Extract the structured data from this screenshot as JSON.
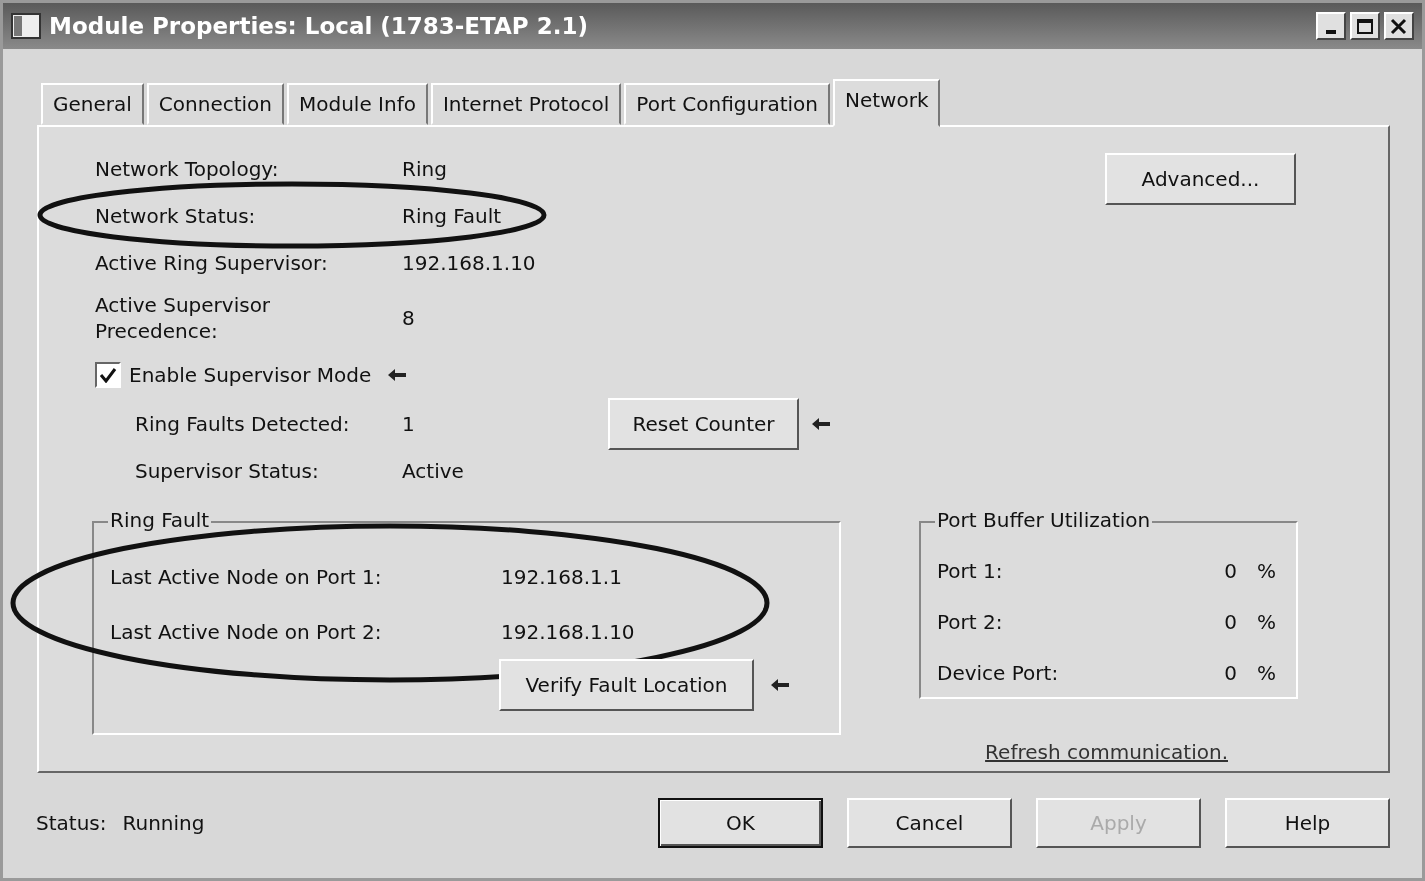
{
  "window": {
    "title": "Module Properties: Local (1783-ETAP 2.1)"
  },
  "tabs": [
    {
      "label": "General",
      "selected": false
    },
    {
      "label": "Connection",
      "selected": false
    },
    {
      "label": "Module Info",
      "selected": false
    },
    {
      "label": "Internet Protocol",
      "selected": false
    },
    {
      "label": "Port Configuration",
      "selected": false
    },
    {
      "label": "Network",
      "selected": true
    }
  ],
  "network": {
    "fields": [
      {
        "label": "Network Topology:",
        "value": "Ring",
        "circled": false
      },
      {
        "label": "Network Status:",
        "value": "Ring Fault",
        "circled": true
      },
      {
        "label": "Active Ring Supervisor:",
        "value": "192.168.1.10",
        "circled": false
      },
      {
        "label": "Active Supervisor Precedence:",
        "value": "8",
        "circled": false
      }
    ],
    "advanced_button": "Advanced...",
    "supervisor_mode": {
      "label": "Enable Supervisor Mode",
      "checked": true,
      "arrow": true
    },
    "supervisor_fields": [
      {
        "label": "Ring Faults Detected:",
        "value": "1"
      },
      {
        "label": "Supervisor Status:",
        "value": "Active"
      }
    ],
    "reset_button": {
      "label": "Reset Counter",
      "arrow": true
    }
  },
  "ring_fault": {
    "title": "Ring Fault",
    "circled": true,
    "rows": [
      {
        "label": "Last Active Node on Port 1:",
        "value": "192.168.1.1"
      },
      {
        "label": "Last Active Node on Port 2:",
        "value": "192.168.1.10"
      }
    ],
    "verify_button": {
      "label": "Verify Fault Location",
      "arrow": true
    }
  },
  "port_buffer": {
    "title": "Port Buffer Utilization",
    "rows": [
      {
        "label": "Port 1:",
        "value": "0",
        "unit": "%"
      },
      {
        "label": "Port 2:",
        "value": "0",
        "unit": "%"
      },
      {
        "label": "Device Port:",
        "value": "0",
        "unit": "%"
      }
    ]
  },
  "refresh_link": "Refresh communication.",
  "status": {
    "label": "Status:",
    "value": "Running"
  },
  "buttons": [
    {
      "label": "OK",
      "default": true,
      "disabled": false
    },
    {
      "label": "Cancel",
      "default": false,
      "disabled": false
    },
    {
      "label": "Apply",
      "default": false,
      "disabled": true
    },
    {
      "label": "Help",
      "default": false,
      "disabled": false
    }
  ]
}
